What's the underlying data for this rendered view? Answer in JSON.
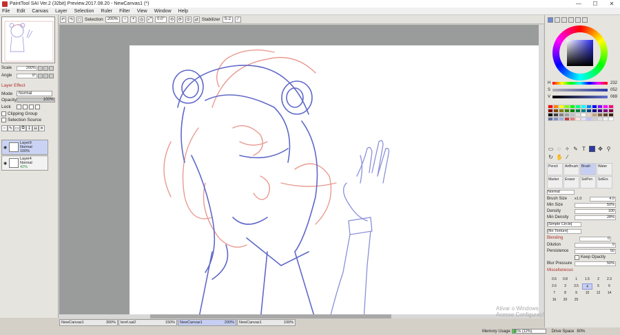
{
  "window": {
    "title": "PaintTool SAI Ver.2 (32bit) Preview.2017.08.20 - NewCanvas1 (*)",
    "minimize": "—",
    "maximize": "☐",
    "close": "✕"
  },
  "menu": [
    "File",
    "Edit",
    "Canvas",
    "Layer",
    "Selection",
    "Ruler",
    "Filter",
    "View",
    "Window",
    "Help"
  ],
  "toolbar": {
    "selection_label": "Selection",
    "zoom": "200%",
    "angle": "0.0°",
    "stabilizer_label": "Stabilizer",
    "stabilizer_value": "S-2"
  },
  "navigator": {
    "scale_label": "Scale",
    "scale_value": "200%",
    "angle_label": "Angle",
    "angle_value": "0°"
  },
  "layer_panel": {
    "effect_label": "Layer Effect",
    "mode_label": "Mode",
    "mode_value": "Normal",
    "opacity_label": "Opacity",
    "opacity_value": "100%",
    "lock_label": "Lock",
    "clipping_group": "Clipping Group",
    "selection_source": "Selection Source",
    "layers": [
      {
        "name": "Layer9",
        "mode": "Normal",
        "opacity": "100%",
        "active": true
      },
      {
        "name": "Layer4",
        "mode": "Normal",
        "opacity": "42%",
        "active": false
      }
    ]
  },
  "color": {
    "h_label": "H",
    "h_value": "232",
    "s_label": "S",
    "s_value": "052",
    "v_label": "V",
    "v_value": "069",
    "current": "#2a3aa8"
  },
  "brushes": [
    {
      "name": "Pencil",
      "sel": false
    },
    {
      "name": "AirBrush",
      "sel": false
    },
    {
      "name": "Brush",
      "sel": true
    },
    {
      "name": "Water",
      "sel": false
    },
    {
      "name": "Marker",
      "sel": false
    },
    {
      "name": "Eraser",
      "sel": false
    },
    {
      "name": "SelPen",
      "sel": false
    },
    {
      "name": "SelErs",
      "sel": false
    }
  ],
  "brush_props": {
    "blend_mode": "Normal",
    "size_label": "Brush Size",
    "size_mult": "x1.0",
    "size_value": "4.0",
    "min_size_label": "Min Size",
    "min_size_value": "50%",
    "density_label": "Density",
    "density_value": "100",
    "min_density_label": "Min Density",
    "min_density_value": "28%",
    "shape": "[Simple Circle]",
    "texture": "[No Texture]",
    "blending_header": "Blending",
    "blending_value": "0",
    "dilution_label": "Dilution",
    "dilution_value": "0",
    "persistence_label": "Persistence",
    "persistence_value": "50",
    "keep_opacity": "Keep Opacity",
    "blur_label": "Blur Pressure",
    "blur_value": "50%",
    "misc_header": "Miscellaneous"
  },
  "size_presets": [
    "0.6",
    "0.8",
    "1",
    "1.5",
    "2",
    "2.3",
    "2.6",
    "3",
    "3.5",
    "4",
    "5",
    "6",
    "7",
    "8",
    "9",
    "10",
    "12",
    "14",
    "16",
    "20",
    "25"
  ],
  "tabs": [
    {
      "name": "NewCanvas1",
      "zoom": "300%",
      "active": false
    },
    {
      "name": "leref.sai2",
      "zoom": "150%",
      "active": false
    },
    {
      "name": "NewCanvas1",
      "zoom": "200%",
      "active": true
    },
    {
      "name": "NewCanvas1",
      "zoom": "100%",
      "active": false
    }
  ],
  "status": {
    "memory_label": "Memory Usage",
    "memory_value": "11% (12%)",
    "memory_fraction": 0.11,
    "drive_label": "Drive Space",
    "drive_value": "80%"
  },
  "watermark": {
    "line1": "Ativar o Windows",
    "line2": "Acesse Configurações"
  },
  "palette_colors": [
    "#ff0000",
    "#ff8000",
    "#ffff00",
    "#80ff00",
    "#00ff00",
    "#00ff80",
    "#00ffff",
    "#0080ff",
    "#0000ff",
    "#8000ff",
    "#ff00ff",
    "#ff0080",
    "#800000",
    "#804000",
    "#808000",
    "#408000",
    "#008000",
    "#008040",
    "#008080",
    "#004080",
    "#000080",
    "#400080",
    "#800080",
    "#800040",
    "#000000",
    "#404040",
    "#808080",
    "#a0a0a0",
    "#c0c0c0",
    "#e0e0e0",
    "#ffffff",
    "#f0d0c0",
    "#c0a080",
    "#806040",
    "#604030",
    "#402010",
    "#6070a0",
    "#8090c0",
    "#a0b0e0",
    "#c04040",
    "#e08080",
    "#ffe0e0",
    "#e0e0ff",
    "#c0c0ff",
    "#d0d0d0",
    "#e0e0e0",
    "#f0f0f0",
    "#ffffff"
  ]
}
